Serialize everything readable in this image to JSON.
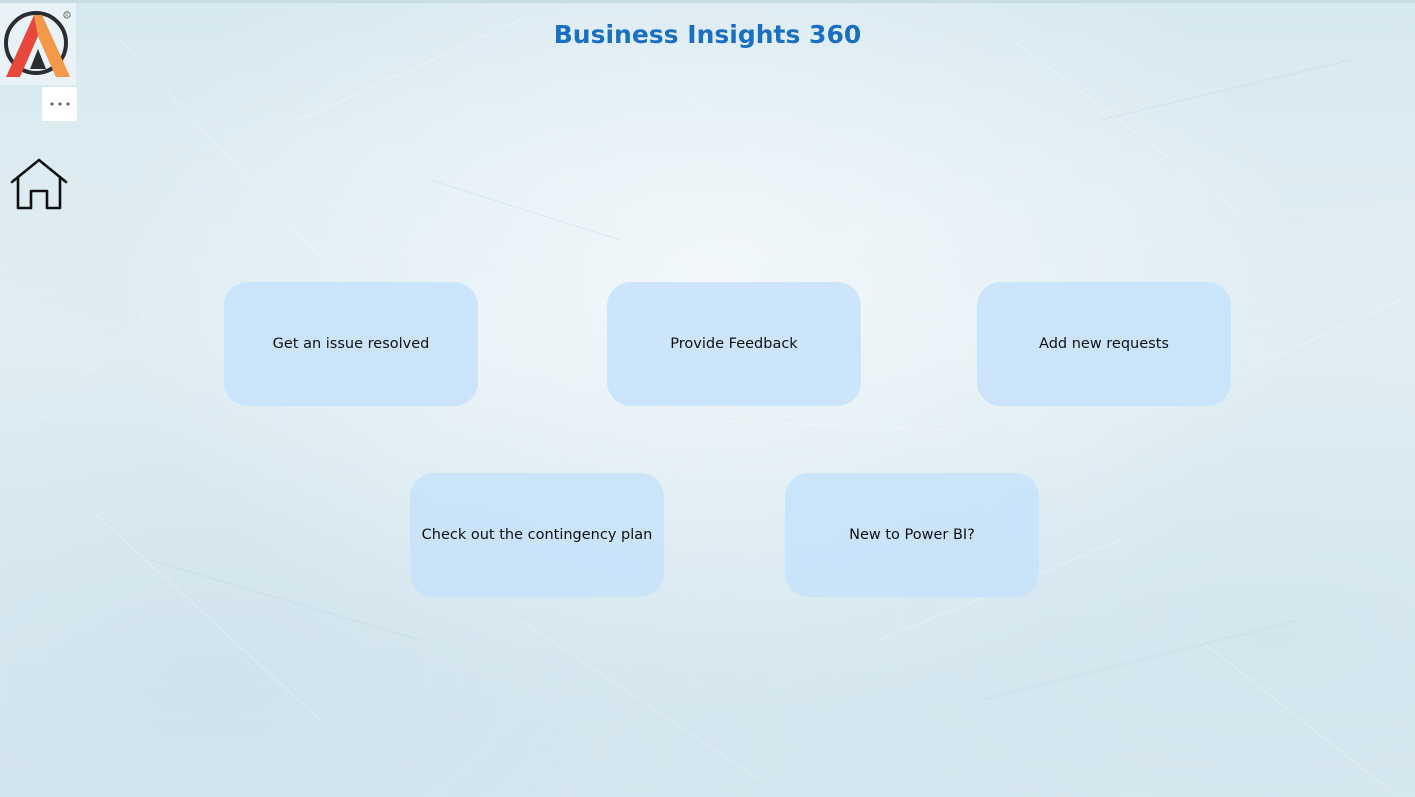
{
  "header": {
    "title": "Business Insights 360"
  },
  "sidebar": {
    "logo_icon": "company-logo",
    "more_icon": "ellipsis-icon",
    "home_icon": "home-icon"
  },
  "tiles": [
    {
      "label": "Get an issue resolved"
    },
    {
      "label": "Provide Feedback"
    },
    {
      "label": "Add new requests"
    },
    {
      "label": "Check out the contingency plan"
    },
    {
      "label": "New to Power BI?"
    }
  ],
  "colors": {
    "title": "#1a6fc1",
    "tile_background": "#c6e2fa",
    "logo_red": "#e8483b",
    "logo_orange": "#f39a4a",
    "logo_dark": "#2b2d33"
  }
}
